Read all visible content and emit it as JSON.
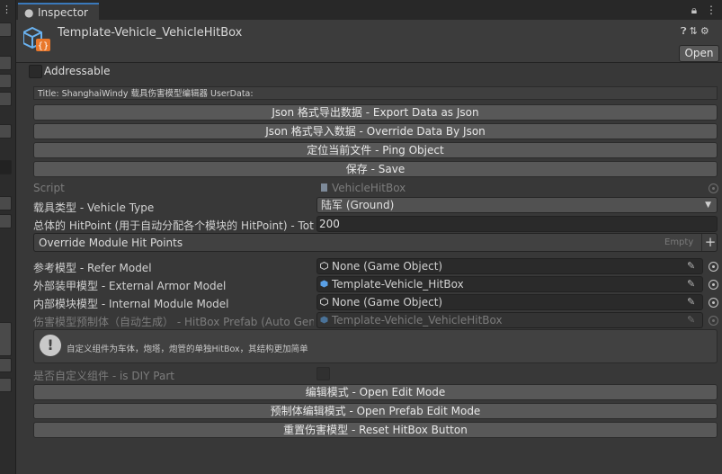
{
  "tab": {
    "title": "Inspector"
  },
  "header": {
    "object_title": "Template-Vehicle_VehicleHitBox",
    "open_label": "Open"
  },
  "addressable": {
    "label": "Addressable",
    "checked": false
  },
  "editor_title": "Title: ShanghaiWindy 载具伤害模型编辑器 UserData:",
  "buttons": {
    "export": "Json 格式导出数据 - Export Data as Json",
    "override": "Json 格式导入数据 - Override Data By Json",
    "ping": "定位当前文件 - Ping Object",
    "save": "保存 - Save",
    "edit_mode": "编辑模式 - Open Edit Mode",
    "prefab_edit_mode": "预制体编辑模式 - Open Prefab Edit Mode",
    "reset_hitbox": "重置伤害模型 - Reset HitBox Button"
  },
  "fields": {
    "script": {
      "label": "Script",
      "value": "VehicleHitBox"
    },
    "vehicle_type": {
      "label": "载具类型 - Vehicle Type",
      "value": "陆军 (Ground)"
    },
    "hitpoint": {
      "label": "总体的 HitPoint (用于自动分配各个模块的 HitPoint) - Tota",
      "value": "200"
    },
    "override_hp": {
      "label": "Override Module Hit Points",
      "empty": "Empty"
    },
    "refer_model": {
      "label": "参考模型 - Refer Model",
      "value": "None (Game Object)"
    },
    "external_armor": {
      "label": "外部装甲模型 - External Armor Model",
      "value": "Template-Vehicle_HitBox"
    },
    "internal_module": {
      "label": "内部模块模型 - Internal Module Model",
      "value": "None (Game Object)"
    },
    "hitbox_prefab": {
      "label": "伤害模型预制体（自动生成） - HitBox Prefab (Auto Gener",
      "value": "Template-Vehicle_VehicleHitBox"
    },
    "diy_part": {
      "label": "是否自定义组件 - is DIY Part",
      "checked": false
    }
  },
  "help": {
    "text": "自定义组件为车体，炮塔，炮管的单独HitBox，其结构更加简单"
  },
  "colors": {
    "accent": "#3a79bb",
    "panel": "#383838",
    "button": "#585858"
  }
}
